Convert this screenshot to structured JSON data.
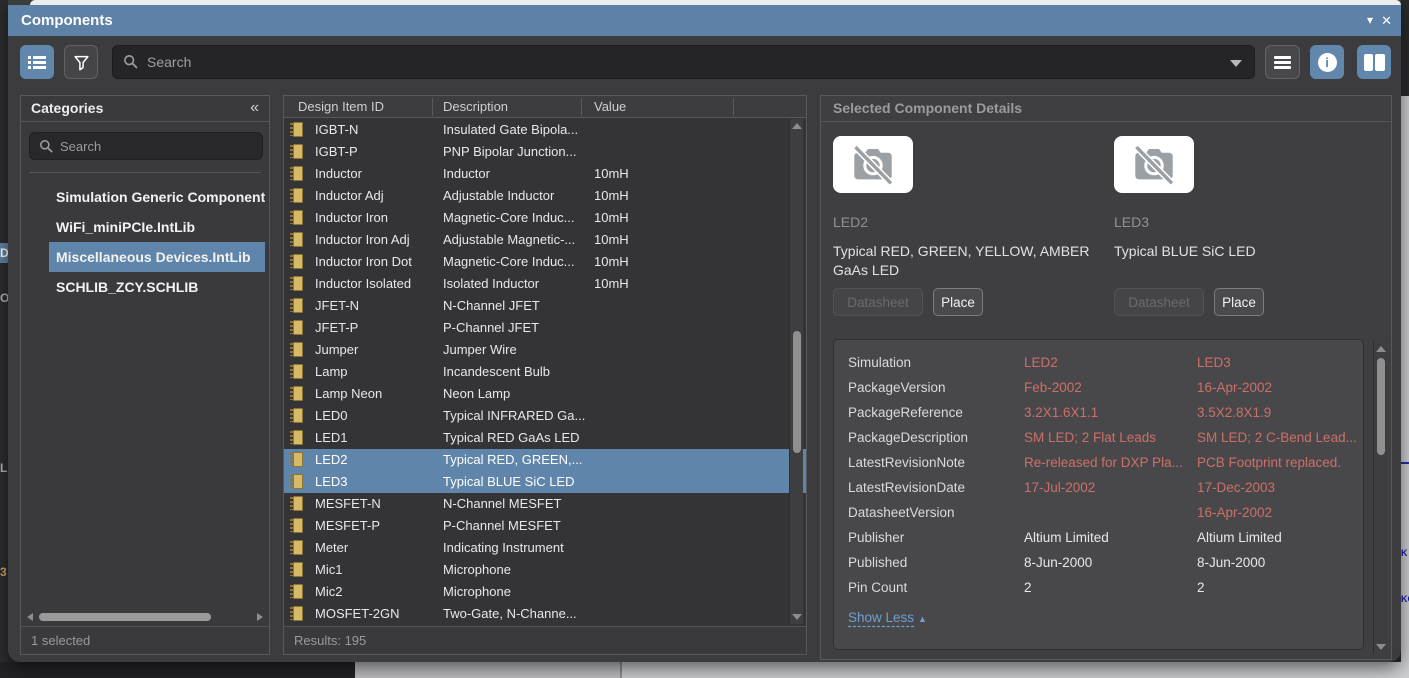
{
  "window": {
    "title": "Components"
  },
  "toolbar": {
    "search_placeholder": "Search"
  },
  "icons": {
    "categories_collapse": "«",
    "window_dropdown": "▾",
    "window_close": "✕",
    "show_less_arrow": "▲"
  },
  "categories": {
    "title": "Categories",
    "search_placeholder": "Search",
    "items": [
      {
        "label": "Simulation Generic Component",
        "selected": false
      },
      {
        "label": "WiFi_miniPCIe.IntLib",
        "selected": false
      },
      {
        "label": "Miscellaneous Devices.IntLib",
        "selected": true
      },
      {
        "label": "SCHLIB_ZCY.SCHLIB",
        "selected": false
      }
    ],
    "status": "1 selected"
  },
  "results": {
    "columns": [
      "Design Item ID",
      "Description",
      "Value"
    ],
    "rows": [
      {
        "id": "IGBT-N",
        "description": "Insulated Gate Bipola...",
        "value": "",
        "selected": false
      },
      {
        "id": "IGBT-P",
        "description": "PNP Bipolar Junction...",
        "value": "",
        "selected": false
      },
      {
        "id": "Inductor",
        "description": "Inductor",
        "value": "10mH",
        "selected": false
      },
      {
        "id": "Inductor Adj",
        "description": "Adjustable Inductor",
        "value": "10mH",
        "selected": false
      },
      {
        "id": "Inductor Iron",
        "description": "Magnetic-Core Induc...",
        "value": "10mH",
        "selected": false
      },
      {
        "id": "Inductor Iron Adj",
        "description": "Adjustable Magnetic-...",
        "value": "10mH",
        "selected": false
      },
      {
        "id": "Inductor Iron Dot",
        "description": "Magnetic-Core Induc...",
        "value": "10mH",
        "selected": false
      },
      {
        "id": "Inductor Isolated",
        "description": "Isolated Inductor",
        "value": "10mH",
        "selected": false
      },
      {
        "id": "JFET-N",
        "description": "N-Channel JFET",
        "value": "",
        "selected": false
      },
      {
        "id": "JFET-P",
        "description": "P-Channel JFET",
        "value": "",
        "selected": false
      },
      {
        "id": "Jumper",
        "description": "Jumper Wire",
        "value": "",
        "selected": false
      },
      {
        "id": "Lamp",
        "description": "Incandescent Bulb",
        "value": "",
        "selected": false
      },
      {
        "id": "Lamp Neon",
        "description": "Neon Lamp",
        "value": "",
        "selected": false
      },
      {
        "id": "LED0",
        "description": "Typical INFRARED Ga...",
        "value": "",
        "selected": false
      },
      {
        "id": "LED1",
        "description": "Typical RED GaAs LED",
        "value": "",
        "selected": false
      },
      {
        "id": "LED2",
        "description": "Typical RED, GREEN,...",
        "value": "",
        "selected": true
      },
      {
        "id": "LED3",
        "description": "Typical BLUE SiC LED",
        "value": "",
        "selected": true
      },
      {
        "id": "MESFET-N",
        "description": "N-Channel MESFET",
        "value": "",
        "selected": false
      },
      {
        "id": "MESFET-P",
        "description": "P-Channel MESFET",
        "value": "",
        "selected": false
      },
      {
        "id": "Meter",
        "description": "Indicating Instrument",
        "value": "",
        "selected": false
      },
      {
        "id": "Mic1",
        "description": "Microphone",
        "value": "",
        "selected": false
      },
      {
        "id": "Mic2",
        "description": "Microphone",
        "value": "",
        "selected": false
      },
      {
        "id": "MOSFET-2GN",
        "description": "Two-Gate, N-Channe...",
        "value": "",
        "selected": false
      }
    ],
    "status": "Results: 195"
  },
  "details": {
    "title": "Selected Component Details",
    "components": [
      {
        "name": "LED2",
        "description": "Typical RED, GREEN, YELLOW, AMBER GaAs LED",
        "datasheet_label": "Datasheet",
        "place_label": "Place"
      },
      {
        "name": "LED3",
        "description": "Typical BLUE SiC LED",
        "datasheet_label": "Datasheet",
        "place_label": "Place"
      }
    ],
    "properties": [
      {
        "label": "Simulation",
        "led2": "LED2",
        "led3": "LED3",
        "highlight": true
      },
      {
        "label": "PackageVersion",
        "led2": "Feb-2002",
        "led3": "16-Apr-2002",
        "highlight": true
      },
      {
        "label": "PackageReference",
        "led2": "3.2X1.6X1.1",
        "led3": "3.5X2.8X1.9",
        "highlight": true
      },
      {
        "label": "PackageDescription",
        "led2": "SM LED; 2 Flat Leads",
        "led3": "SM LED; 2 C-Bend Lead...",
        "highlight": true
      },
      {
        "label": "LatestRevisionNote",
        "led2": "Re-released for DXP Pla...",
        "led3": "PCB Footprint replaced.",
        "highlight": true
      },
      {
        "label": "LatestRevisionDate",
        "led2": "17-Jul-2002",
        "led3": "17-Dec-2003",
        "highlight": true
      },
      {
        "label": "DatasheetVersion",
        "led2": "",
        "led3": "16-Apr-2002",
        "highlight": true
      },
      {
        "label": "Publisher",
        "led2": "Altium Limited",
        "led3": "Altium Limited",
        "highlight": false
      },
      {
        "label": "Published",
        "led2": "8-Jun-2000",
        "led3": "8-Jun-2000",
        "highlight": false
      },
      {
        "label": "Pin Count",
        "led2": "2",
        "led3": "2",
        "highlight": false
      }
    ],
    "show_less_label": "Show Less"
  },
  "background": {
    "left_fragments": [
      "D",
      "Oc",
      "Li",
      "3"
    ],
    "right_fragments": [
      "K",
      "KO"
    ]
  },
  "colors": {
    "titlebar": "#5d81a7",
    "accent_button": "#6287ac",
    "selection": "#5f85ab",
    "modified_value": "#cd6f68",
    "link": "#6f9fd0",
    "icon_gold": "#d7ba68"
  }
}
